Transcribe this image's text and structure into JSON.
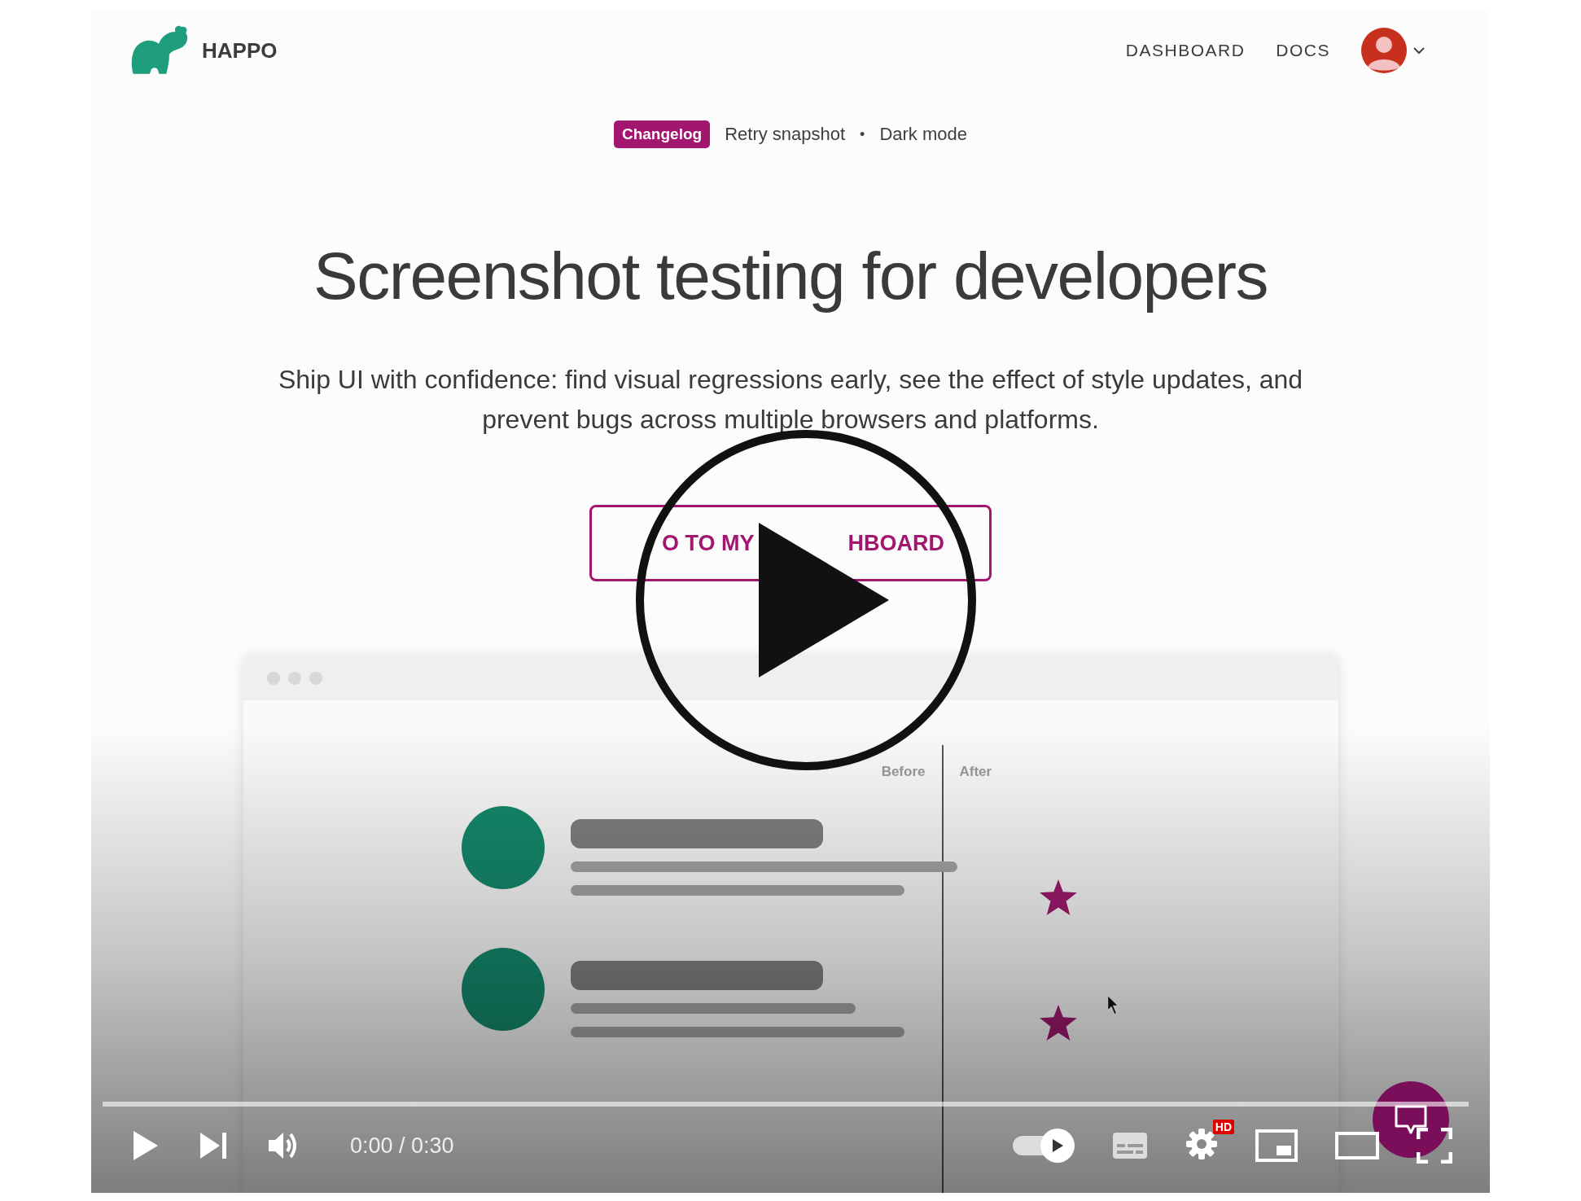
{
  "nav": {
    "brand": "HAPPO",
    "links": [
      "DASHBOARD",
      "DOCS"
    ]
  },
  "announcement": {
    "badge": "Changelog",
    "items": [
      "Retry snapshot",
      "Dark mode"
    ],
    "separator": "•"
  },
  "headline": "Screenshot testing for developers",
  "subtitle": "Ship UI with confidence: find visual regressions early, see the effect of style updates, and prevent bugs across multiple browsers and platforms.",
  "cta": {
    "label_parts": [
      "O TO MY",
      "HBOARD"
    ]
  },
  "mockup": {
    "labels": [
      "Before",
      "After"
    ]
  },
  "player": {
    "time": "0:00 / 0:30",
    "hd_badge": "HD",
    "progress": {
      "level": 0
    },
    "autoplay": {
      "on": true
    }
  }
}
